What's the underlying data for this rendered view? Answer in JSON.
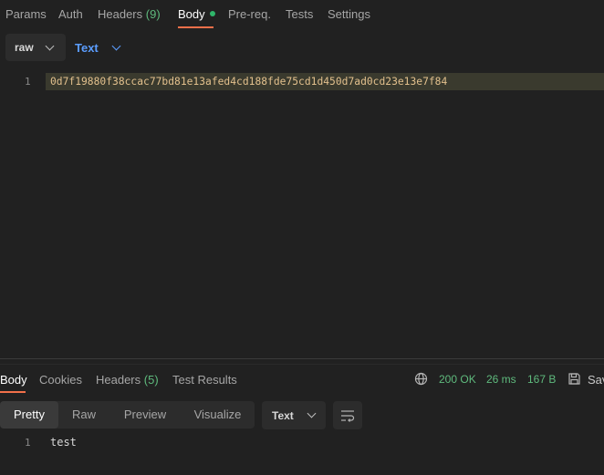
{
  "request_tabs": [
    {
      "label": "Params"
    },
    {
      "label": "Auth"
    },
    {
      "label": "Headers",
      "count": "(9)"
    },
    {
      "label": "Body",
      "active": true
    },
    {
      "label": "Pre-req."
    },
    {
      "label": "Tests"
    },
    {
      "label": "Settings"
    }
  ],
  "body_mode": "raw",
  "body_format": "Text",
  "editor": {
    "lines": [
      {
        "number": "1",
        "text": "0d7f19880f38ccac77bd81e13afed4cd188fde75cd1d450d7ad0cd23e13e7f84"
      }
    ]
  },
  "response_tabs": [
    {
      "label": "Body",
      "active": true
    },
    {
      "label": "Cookies"
    },
    {
      "label": "Headers",
      "count": "(5)"
    },
    {
      "label": "Test Results"
    }
  ],
  "response_meta": {
    "status": "200 OK",
    "time": "26 ms",
    "size": "167 B",
    "save_label": "Sav"
  },
  "view_modes": [
    "Pretty",
    "Raw",
    "Preview",
    "Visualize"
  ],
  "active_view": "Pretty",
  "response_format": "Text",
  "response_body": {
    "lines": [
      {
        "number": "1",
        "text": "test"
      }
    ]
  },
  "colors": {
    "background": "#212121",
    "accent": "#f2704a",
    "success": "#5fba7d",
    "link": "#5b9dff"
  }
}
